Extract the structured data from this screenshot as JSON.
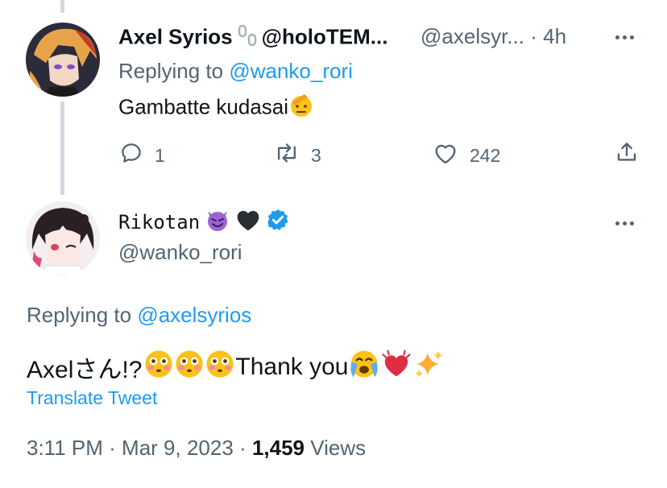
{
  "reply_tweet": {
    "display_name": "Axel Syrios",
    "name_emoji": "chain-link-icon",
    "name_suffix": "@holoTEM...",
    "handle": "@axelsyr...",
    "separator": "·",
    "time": "4h",
    "replying_prefix": "Replying to",
    "replying_handle": "@wanko_rori",
    "text": "Gambatte kudasai",
    "text_emoji": "saluting-face-icon",
    "reply_count": "1",
    "retweet_count": "3",
    "like_count": "242"
  },
  "main_tweet": {
    "display_name": "Rikotan",
    "name_emojis": [
      "smiling-devil-icon",
      "black-heart-icon",
      "verified-badge-icon"
    ],
    "handle": "@wanko_rori",
    "replying_prefix": "Replying to",
    "replying_handle": "@axelsyrios",
    "text_part1": "Axelさん!?",
    "text_emojis_1": [
      "flushed-face-icon",
      "flushed-face-icon",
      "flushed-face-icon"
    ],
    "text_part2": "Thank you",
    "text_emojis_2": [
      "crying-face-icon",
      "beating-heart-icon",
      "sparkles-icon"
    ],
    "translate_label": "Translate Tweet",
    "time": "3:11 PM",
    "date": "Mar 9, 2023",
    "separator": "·",
    "views_count": "1,459",
    "views_label": "Views"
  },
  "colors": {
    "link": "#1d9bf0",
    "secondary_text": "#536471",
    "verified": "#1d9bf0",
    "thread_line": "#cfd9de"
  }
}
